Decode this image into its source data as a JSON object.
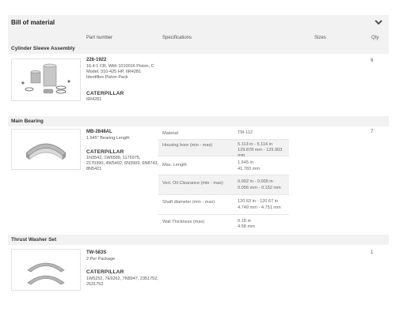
{
  "header": {
    "title": "Bill of material"
  },
  "columns": {
    "part_number": "Part number",
    "specifications": "Specifications",
    "sizes": "Sizes",
    "qty": "Qty"
  },
  "sections": [
    {
      "name": "Cylinder Sleeve Assembly",
      "part_number": "226-1922",
      "description": [
        "16.4:1 CR, With 1010016 Piston, C",
        "Model, 310-425 HP, 6R4281",
        "Identifies Piston Pack"
      ],
      "brand": "CATERPILLAR",
      "refs": [
        "6R4281"
      ],
      "qty": "6"
    },
    {
      "name": "Main Bearing",
      "part_number": "MB-2848AL",
      "description": [
        "1.645\" Bearing Length"
      ],
      "brand": "CATERPILLAR",
      "refs": [
        "1N3542, 1W6589, 1175975,",
        "2170390, 4W5492, 6N3909, 6N8743,",
        "8N5421"
      ],
      "qty": "7",
      "specs": [
        {
          "label": "Material",
          "values": [
            "TM-112"
          ]
        },
        {
          "label": "Housing bore (min - max)",
          "values": [
            "5.113 in - 5.114 in",
            "129.878 mm - 129.903 mm"
          ]
        },
        {
          "label": "Max. Length",
          "values": [
            "1.645 in",
            "41.783 mm"
          ]
        },
        {
          "label": "Vert. Oil Clearance (min - max)",
          "values": [
            "0.002 in - 0.006 in",
            "0.056 mm - 0.152 mm"
          ]
        },
        {
          "label": "Shaft diameter (min - max)",
          "values": [
            "120.63 in - 120.67 in",
            "4.749 mm - 4.751 mm"
          ]
        },
        {
          "label": "Wall Thickness (max)",
          "values": [
            "0.18 in",
            "4.58 mm"
          ]
        }
      ]
    },
    {
      "name": "Thrust Washer Set",
      "part_number": "TW-583S",
      "description": [
        "2 Per Package"
      ],
      "brand": "CATERPILLAR",
      "refs": [
        "1W5252, 7E9262, 7N8947, 2351752,",
        "2531752"
      ],
      "qty": "1"
    }
  ],
  "icons": {
    "chevron": "chevron-down-icon"
  },
  "colors": {
    "header_bg": "#f2f2f2",
    "text": "#333333",
    "muted": "#666666"
  }
}
